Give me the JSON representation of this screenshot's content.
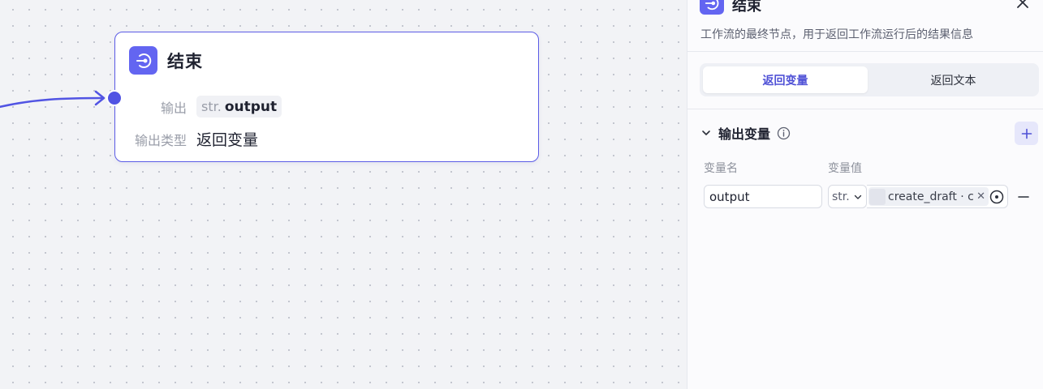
{
  "node": {
    "title": "结束",
    "output_label": "输出",
    "output_type_badge": "str.",
    "output_value": "output",
    "output_type_label": "输出类型",
    "output_type_value": "返回变量"
  },
  "panel": {
    "title": "结束",
    "description": "工作流的最终节点，用于返回工作流运行后的结果信息",
    "tabs": [
      {
        "label": "返回变量",
        "active": true
      },
      {
        "label": "返回文本",
        "active": false
      }
    ],
    "section_title": "输出变量",
    "columns": {
      "name": "变量名",
      "value": "变量值"
    },
    "variables": [
      {
        "name": "output",
        "type": "str.",
        "ref": "create_draft · c"
      }
    ]
  },
  "colors": {
    "accent": "#5b5ce6",
    "icon_bg": "#6365f1"
  }
}
